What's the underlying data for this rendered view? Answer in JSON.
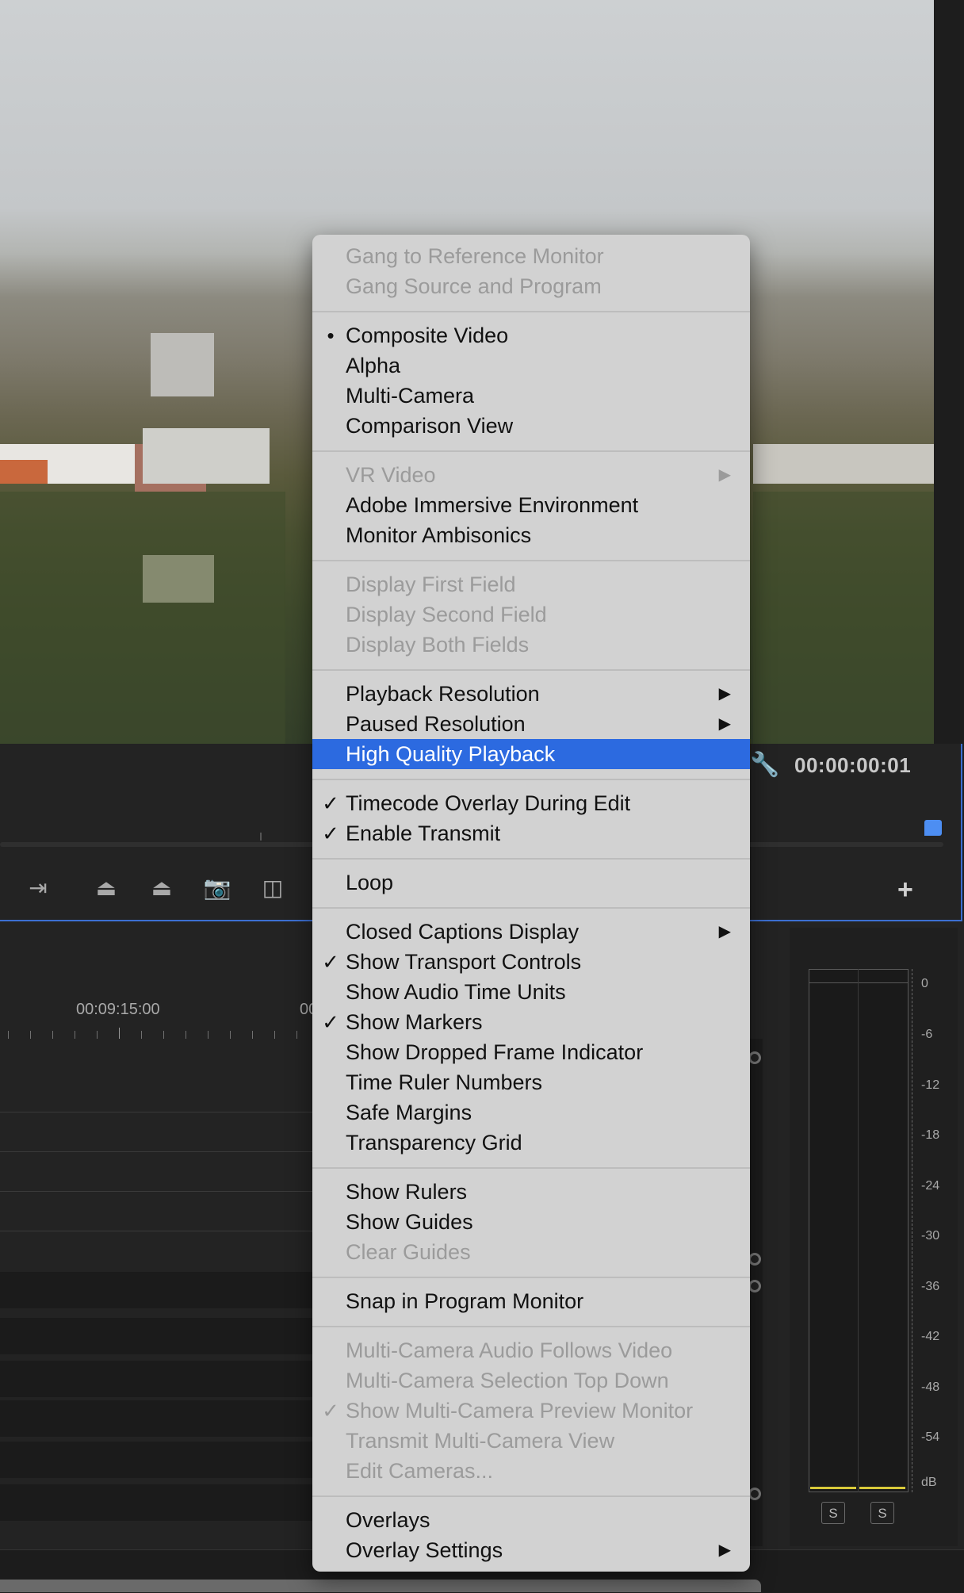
{
  "monitor": {
    "timecode": "00:00:00:01",
    "icons": [
      "wrench-icon",
      "insert-icon",
      "lift-icon",
      "extract-icon",
      "camera-icon",
      "compare-icon",
      "add-icon"
    ],
    "add_label": "+"
  },
  "timeline": {
    "time_label": "00:09:15:00",
    "time_label_2": "00"
  },
  "audio_meter": {
    "db_labels": [
      "0",
      "-6",
      "-12",
      "-18",
      "-24",
      "-30",
      "-36",
      "-42",
      "-48",
      "-54",
      "dB"
    ],
    "solo_left": "S",
    "solo_right": "S"
  },
  "menu": {
    "items": [
      {
        "label": "Gang to Reference Monitor",
        "state": "disabled"
      },
      {
        "label": "Gang Source and Program",
        "state": "disabled"
      },
      {
        "label": "Composite Video",
        "state": "enabled",
        "mark": "•"
      },
      {
        "label": "Alpha",
        "state": "enabled"
      },
      {
        "label": "Multi-Camera",
        "state": "enabled"
      },
      {
        "label": "Comparison View",
        "state": "enabled"
      },
      {
        "label": "VR Video",
        "state": "disabled",
        "submenu": "▶"
      },
      {
        "label": "Adobe Immersive Environment",
        "state": "enabled"
      },
      {
        "label": "Monitor Ambisonics",
        "state": "enabled"
      },
      {
        "label": "Display First Field",
        "state": "disabled"
      },
      {
        "label": "Display Second Field",
        "state": "disabled"
      },
      {
        "label": "Display Both Fields",
        "state": "disabled"
      },
      {
        "label": "Playback Resolution",
        "state": "enabled",
        "submenu": "▶"
      },
      {
        "label": "Paused Resolution",
        "state": "enabled",
        "submenu": "▶"
      },
      {
        "label": "High Quality Playback",
        "state": "highlighted"
      },
      {
        "label": "Timecode Overlay During Edit",
        "state": "enabled",
        "mark": "✓"
      },
      {
        "label": "Enable Transmit",
        "state": "enabled",
        "mark": "✓"
      },
      {
        "label": "Loop",
        "state": "enabled"
      },
      {
        "label": "Closed Captions Display",
        "state": "enabled",
        "submenu": "▶"
      },
      {
        "label": "Show Transport Controls",
        "state": "enabled",
        "mark": "✓"
      },
      {
        "label": "Show Audio Time Units",
        "state": "enabled"
      },
      {
        "label": "Show Markers",
        "state": "enabled",
        "mark": "✓"
      },
      {
        "label": "Show Dropped Frame Indicator",
        "state": "enabled"
      },
      {
        "label": "Time Ruler Numbers",
        "state": "enabled"
      },
      {
        "label": "Safe Margins",
        "state": "enabled"
      },
      {
        "label": "Transparency Grid",
        "state": "enabled"
      },
      {
        "label": "Show Rulers",
        "state": "enabled"
      },
      {
        "label": "Show Guides",
        "state": "enabled"
      },
      {
        "label": "Clear Guides",
        "state": "disabled"
      },
      {
        "label": "Snap in Program Monitor",
        "state": "enabled"
      },
      {
        "label": "Multi-Camera Audio Follows Video",
        "state": "disabled"
      },
      {
        "label": "Multi-Camera Selection Top Down",
        "state": "disabled"
      },
      {
        "label": "Show Multi-Camera Preview Monitor",
        "state": "disabled",
        "mark": "✓"
      },
      {
        "label": "Transmit Multi-Camera View",
        "state": "disabled"
      },
      {
        "label": "Edit Cameras...",
        "state": "disabled"
      },
      {
        "label": "Overlays",
        "state": "enabled"
      },
      {
        "label": "Overlay Settings",
        "state": "enabled",
        "submenu": "▶"
      }
    ],
    "highlight_color": "#2c6ae0"
  }
}
